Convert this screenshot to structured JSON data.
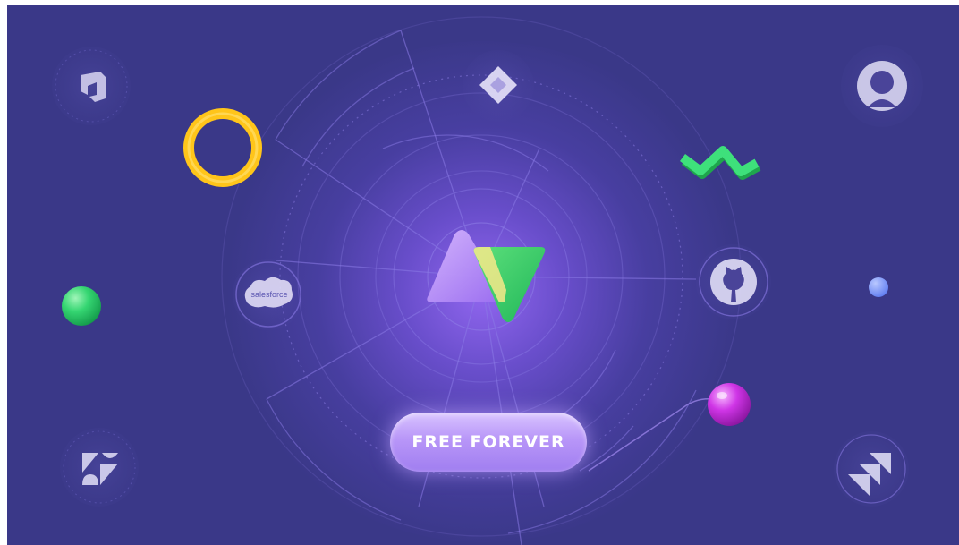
{
  "cta": {
    "label": "FREE FOREVER"
  },
  "integrations": {
    "salesforce_label": "salesforce",
    "icons": [
      "azure-devops-icon",
      "jira-icon",
      "circle-logo-icon",
      "wave-logo-icon",
      "github-icon",
      "salesforce-icon",
      "zendesk-icon",
      "jira-align-icon",
      "center-triangles-logo-icon"
    ]
  },
  "colors": {
    "background": "#3a3888",
    "glow": "#9b6cf5",
    "button": "#b896f8",
    "green": "#33d36e",
    "yellow": "#ffc51a",
    "magenta": "#c42be0",
    "blue": "#6f8cff"
  }
}
